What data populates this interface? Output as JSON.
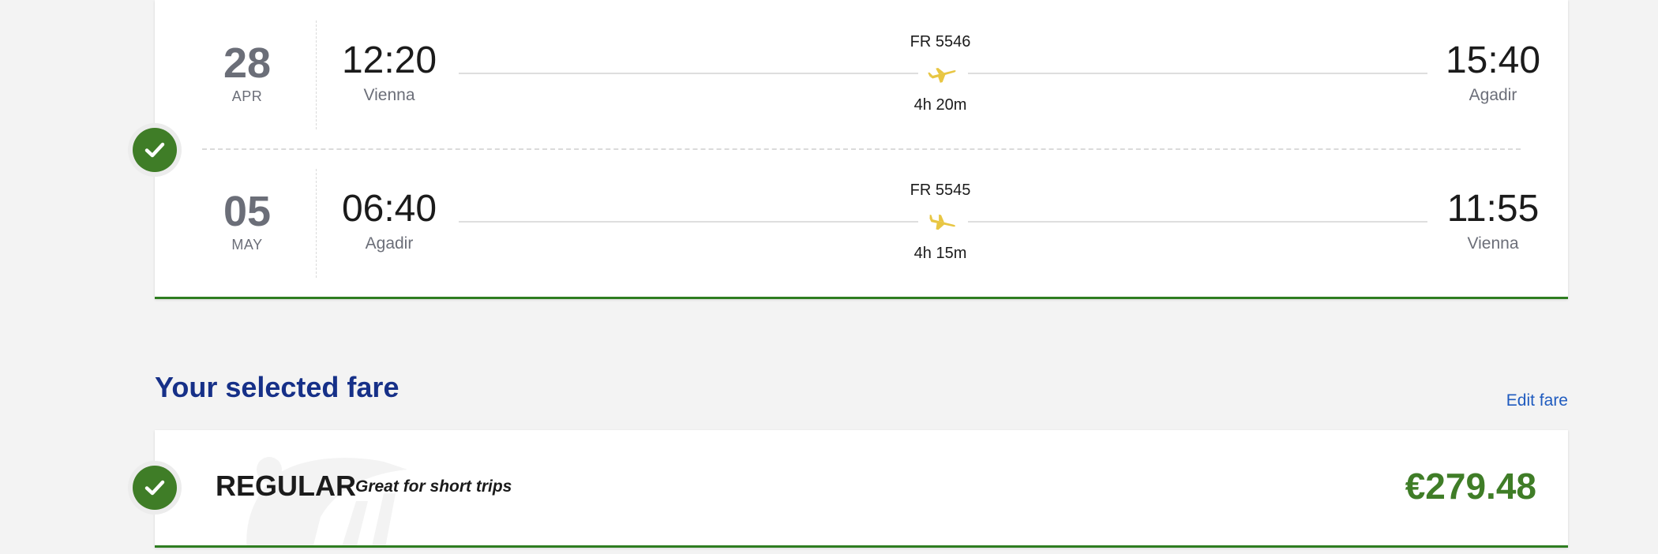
{
  "flights": {
    "outbound": {
      "date_day": "28",
      "date_month": "APR",
      "departure_time": "12:20",
      "departure_city": "Vienna",
      "flight_number": "FR 5546",
      "duration": "4h 20m",
      "arrival_time": "15:40",
      "arrival_city": "Agadir",
      "icon": "plane-takeoff-icon"
    },
    "return": {
      "date_day": "05",
      "date_month": "MAY",
      "departure_time": "06:40",
      "departure_city": "Agadir",
      "flight_number": "FR 5545",
      "duration": "4h 15m",
      "arrival_time": "11:55",
      "arrival_city": "Vienna",
      "icon": "plane-landing-icon"
    },
    "status_icon": "check-icon"
  },
  "fare": {
    "section_title": "Your selected fare",
    "edit_label": "Edit fare",
    "name": "REGULAR",
    "description": "Great for short trips",
    "price": "€279.48",
    "status_icon": "check-icon"
  },
  "colors": {
    "background": "#f3f3f3",
    "card": "#ffffff",
    "accent_green": "#3f7d27",
    "title_blue": "#163088",
    "link_blue": "#1f5bbf",
    "plane_yellow": "#e8c643"
  }
}
